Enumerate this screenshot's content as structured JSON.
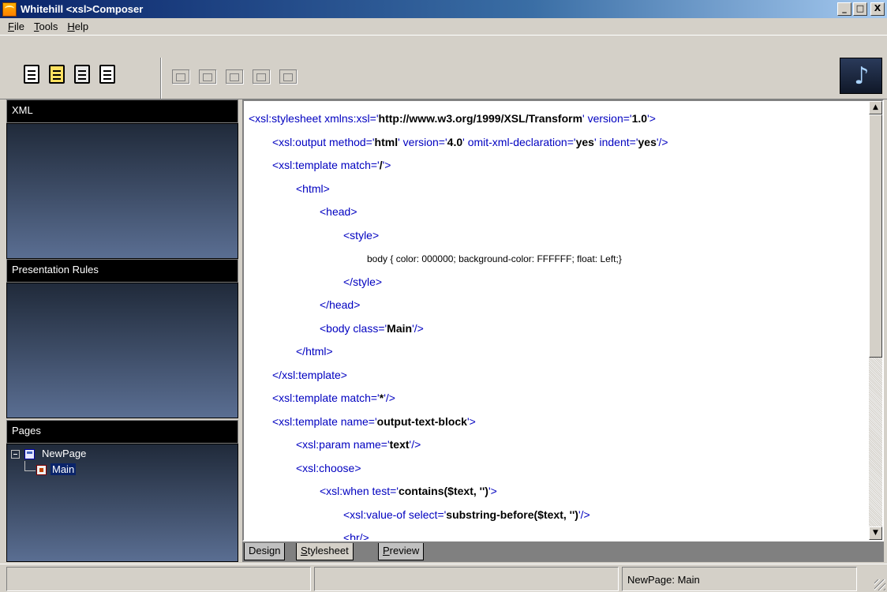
{
  "window": {
    "title": "Whitehill <xsl>Composer",
    "min": "_",
    "max": "□",
    "close": "X"
  },
  "menu": {
    "file_first": "F",
    "file_rest": "ile",
    "tools_first": "T",
    "tools_rest": "ools",
    "help_first": "H",
    "help_rest": "elp"
  },
  "toolbar": {
    "music_icon": "♪"
  },
  "panels": {
    "xml": "XML",
    "presentation_rules": "Presentation Rules",
    "pages": "Pages"
  },
  "tree": {
    "root": "NewPage",
    "child": "Main"
  },
  "code": [
    {
      "p": [
        "<xsl:stylesheet xmlns:xsl='",
        "http://www.w3.org/1999/XSL/Transform",
        "' version='",
        "1.0",
        "'>"
      ]
    },
    {
      "p": [
        "<xsl:output method='",
        "html",
        "' version='",
        "4.0",
        "' omit-xml-declaration='",
        "yes",
        "' indent='",
        "yes",
        "'/>"
      ]
    },
    {
      "p": [
        "<xsl:template match='",
        "/",
        "'>"
      ]
    },
    {
      "p": [
        "<html>"
      ]
    },
    {
      "p": [
        "<head>"
      ]
    },
    {
      "p": [
        "<style>"
      ]
    },
    {
      "t": "body { color: 000000; background-color: FFFFFF; float: Left;}"
    },
    {
      "p": [
        "</style>"
      ]
    },
    {
      "p": [
        "</head>"
      ]
    },
    {
      "p": [
        "<body class='",
        "Main",
        "'/>"
      ]
    },
    {
      "p": [
        "</html>"
      ]
    },
    {
      "p": [
        "</xsl:template>"
      ]
    },
    {
      "p": [
        "<xsl:template match='",
        "*",
        "'/>"
      ]
    },
    {
      "p": [
        "<xsl:template name='",
        "output-text-block",
        "'>"
      ]
    },
    {
      "p": [
        "<xsl:param name='",
        "text",
        "'/>"
      ]
    },
    {
      "p": [
        "<xsl:choose>"
      ]
    },
    {
      "p": [
        "<xsl:when test='",
        "contains($text, '')",
        "'>"
      ]
    },
    {
      "p": [
        "<xsl:value-of select='",
        "substring-before($text, '')",
        "'/>"
      ]
    },
    {
      "p": [
        "<br/>"
      ]
    }
  ],
  "scrollbar": {
    "up": "▲",
    "down": "▼"
  },
  "tabs": {
    "design": "Design",
    "stylesheet_first": "S",
    "stylesheet_rest": "tylesheet",
    "preview_first": "P",
    "preview_rest": "review"
  },
  "status": {
    "cell1": "",
    "cell2": "",
    "cell3": "NewPage: Main"
  }
}
